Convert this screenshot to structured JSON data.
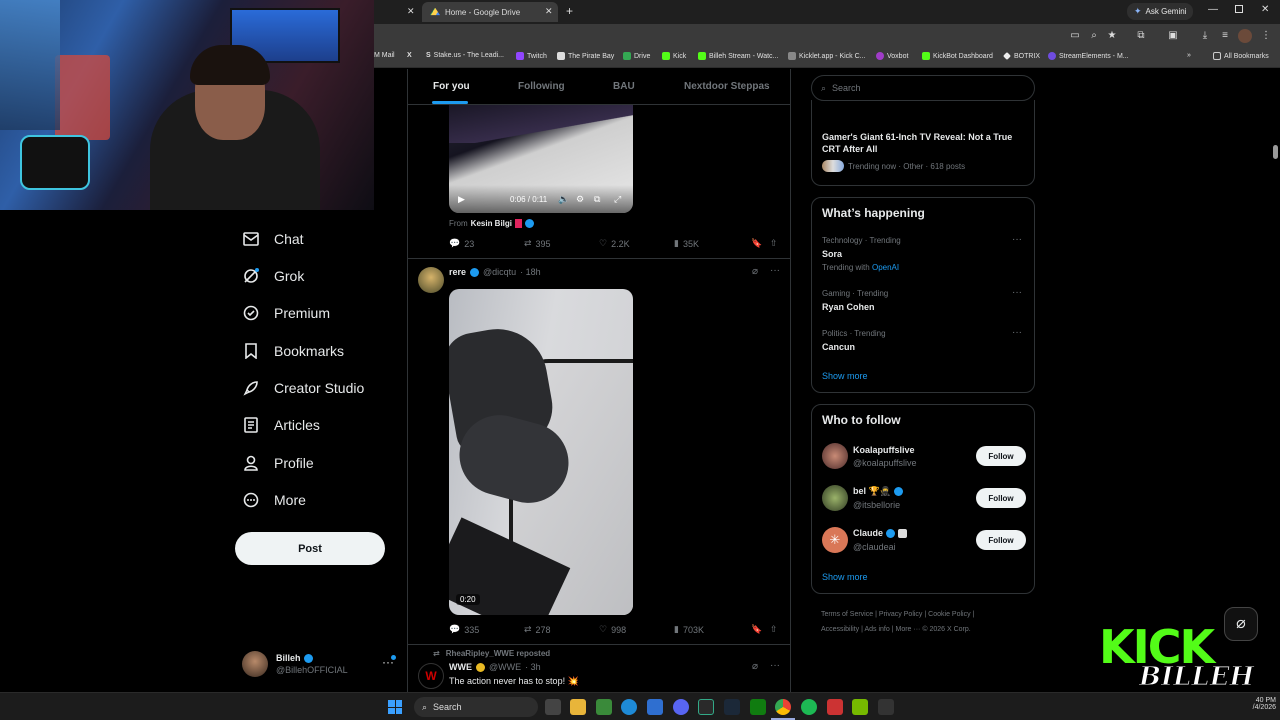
{
  "browser": {
    "tabs": [
      {
        "label": ""
      },
      {
        "label": "Home - Google Drive"
      }
    ],
    "ask_gemini": "Ask Gemini",
    "bookmarks": [
      "M Mail",
      "Stake.us - The Leadi...",
      "Twitch",
      "The Pirate Bay",
      "Drive",
      "Kick",
      "Billeh Stream - Watc...",
      "Kicklet.app - Kick C...",
      "Voxbot",
      "KickBot Dashboard",
      "BOTRIX",
      "StreamElements - M..."
    ],
    "all_bookmarks": "All Bookmarks"
  },
  "nav": {
    "items": [
      {
        "label": "Chat",
        "icon": "mail-icon"
      },
      {
        "label": "Grok",
        "icon": "grok-icon"
      },
      {
        "label": "Premium",
        "icon": "verified-icon"
      },
      {
        "label": "Bookmarks",
        "icon": "bookmark-icon"
      },
      {
        "label": "Creator Studio",
        "icon": "rocket-icon"
      },
      {
        "label": "Articles",
        "icon": "document-icon"
      },
      {
        "label": "Profile",
        "icon": "person-icon"
      },
      {
        "label": "More",
        "icon": "more-icon"
      }
    ],
    "post_label": "Post",
    "account": {
      "name": "Billeh",
      "handle": "@BillehOFFICIAL"
    }
  },
  "feed": {
    "tabs": [
      "For you",
      "Following",
      "BAU",
      "Nextdoor Steppas"
    ],
    "post1": {
      "video_time": "0:06 / 0:11",
      "from_prefix": "From",
      "from_name": "Kesin Bilgi",
      "stats": {
        "replies": "23",
        "reposts": "395",
        "likes": "2.2K",
        "views": "35K"
      }
    },
    "post2": {
      "name": "rere",
      "handle": "@dicqtu",
      "time": "· 18h",
      "duration": "0:20",
      "stats": {
        "replies": "335",
        "reposts": "278",
        "likes": "998",
        "views": "703K"
      }
    },
    "post3": {
      "repost_line": "RheaRipley_WWE reposted",
      "name": "WWE",
      "handle": "@WWE",
      "time": "· 3h",
      "text": "The action never has to stop! 💥"
    }
  },
  "right": {
    "search_placeholder": "Search",
    "top_story": {
      "title": "Gamer's Giant 61-Inch TV Reveal: Not a True CRT After All",
      "meta": "Trending now · Other · 618 posts"
    },
    "whats_happening": {
      "title": "What’s happening",
      "items": [
        {
          "context": "Technology · Trending",
          "topic": "Sora",
          "extra_prefix": "Trending with",
          "extra_link": "OpenAI"
        },
        {
          "context": "Gaming · Trending",
          "topic": "Ryan Cohen"
        },
        {
          "context": "Politics · Trending",
          "topic": "Cancun"
        }
      ],
      "show_more": "Show more"
    },
    "who_to_follow": {
      "title": "Who to follow",
      "users": [
        {
          "name": "Koalapuffslive",
          "handle": "@koalapuffslive"
        },
        {
          "name": "bel 🏆🥷",
          "handle": "@itsbellorie"
        },
        {
          "name": "Claude",
          "handle": "@claudeai"
        }
      ],
      "follow_label": "Follow",
      "show_more": "Show more"
    },
    "footer": [
      "Terms of Service",
      "Privacy Policy",
      "Cookie Policy",
      "Accessibility",
      "Ads info",
      "More ···",
      "© 2026 X Corp."
    ]
  },
  "overlay": {
    "logo_top": "KICK",
    "logo_bottom": "BILLEH"
  },
  "taskbar": {
    "search": "Search",
    "time": "40 PM",
    "date": "/4/2026"
  },
  "colors": {
    "accent": "#1d9bf0",
    "kick_green": "#53fc18",
    "bg": "#000000",
    "border": "#2f3336"
  }
}
